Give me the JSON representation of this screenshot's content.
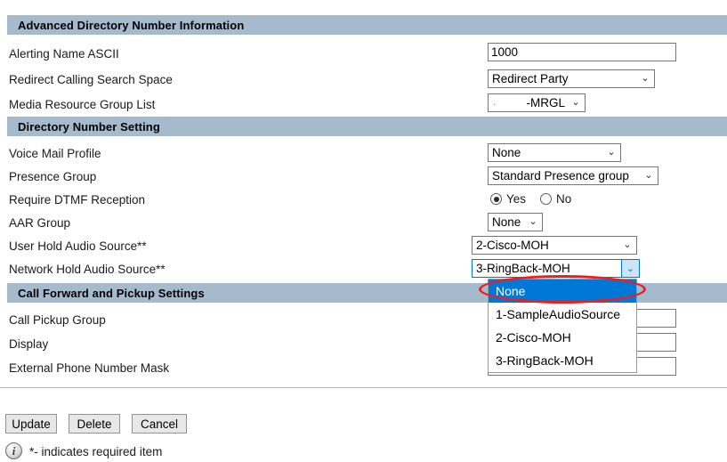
{
  "sections": [
    {
      "id": "advanced",
      "title": "Advanced Directory Number Information"
    },
    {
      "id": "dnsetting",
      "title": "Directory Number Setting"
    },
    {
      "id": "callfwd",
      "title": "Call Forward and Pickup Settings"
    }
  ],
  "fields": {
    "alerting_name_ascii": {
      "label": "Alerting Name ASCII",
      "value": "1000"
    },
    "redirect_css": {
      "label": "Redirect Calling Search Space",
      "value": "Redirect Party"
    },
    "media_resource_group_list": {
      "label": "Media Resource Group List",
      "value": "-MRGL"
    },
    "voice_mail_profile": {
      "label": "Voice Mail Profile",
      "value": "None"
    },
    "presence_group": {
      "label": "Presence Group",
      "value": "Standard Presence group"
    },
    "require_dtmf_reception": {
      "label": "Require DTMF Reception",
      "options": [
        "Yes",
        "No"
      ],
      "selected": "Yes"
    },
    "aar_group": {
      "label": "AAR Group",
      "value": "None"
    },
    "user_hold_audio_source": {
      "label": "User Hold Audio Source**",
      "value": "2-Cisco-MOH"
    },
    "network_hold_audio_source": {
      "label": "Network Hold Audio Source**",
      "value": "3-RingBack-MOH",
      "expanded": true,
      "options": [
        "None",
        "1-SampleAudioSource",
        "2-Cisco-MOH",
        "3-RingBack-MOH"
      ],
      "highlighted_option": "None"
    },
    "call_pickup_group": {
      "label": "Call Pickup Group",
      "value": ""
    },
    "display": {
      "label": "Display",
      "value": ""
    },
    "external_phone_number_mask": {
      "label": "External Phone Number Mask",
      "value": ""
    }
  },
  "buttons": {
    "update": "Update",
    "delete": "Delete",
    "cancel": "Cancel"
  },
  "footer": {
    "info_glyph": "i",
    "note": "*- indicates required item"
  },
  "icons": {
    "chevron_down": "⌄"
  },
  "colors": {
    "section_bar": "#a5bacd",
    "highlight_blue": "#0078d7",
    "annotation_red": "#e8201f",
    "focus_border": "#0078d7"
  }
}
